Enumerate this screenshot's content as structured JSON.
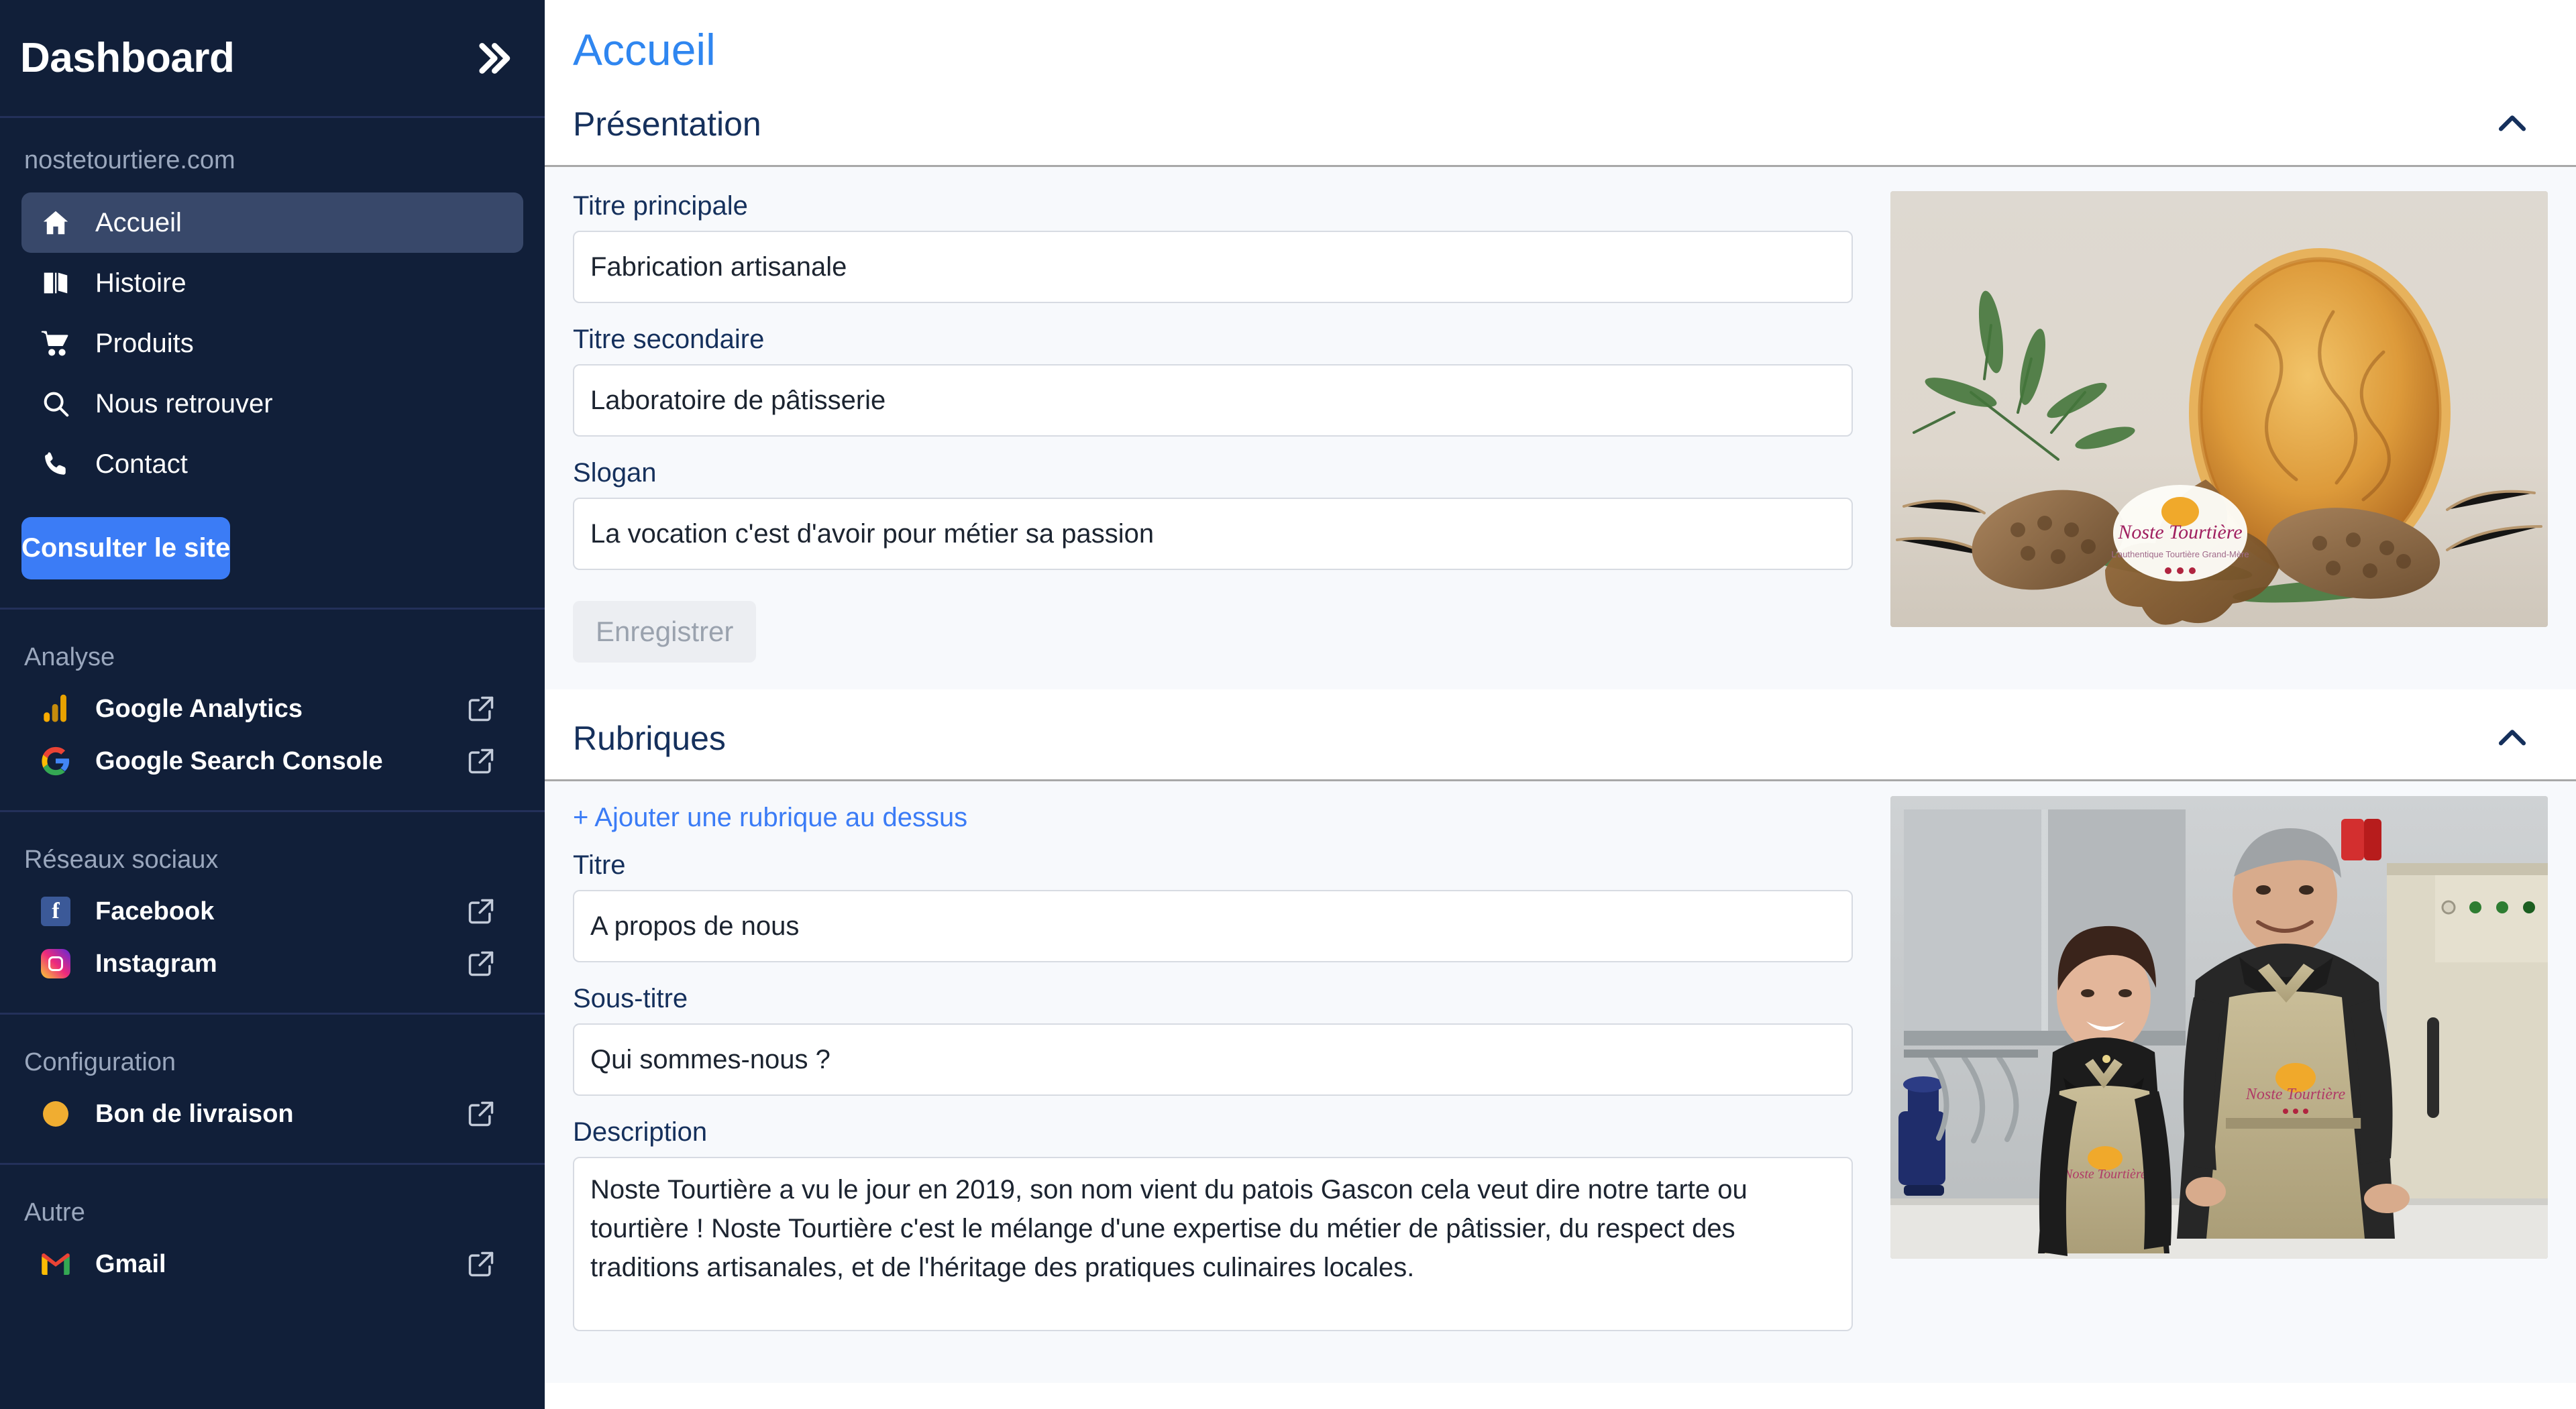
{
  "sidebar": {
    "title": "Dashboard",
    "collapse_icon": "chevron-double-right-icon",
    "domain": "nostetourtiere.com",
    "nav": [
      {
        "label": "Accueil",
        "icon": "home-icon",
        "active": true
      },
      {
        "label": "Histoire",
        "icon": "book-icon",
        "active": false
      },
      {
        "label": "Produits",
        "icon": "cart-icon",
        "active": false
      },
      {
        "label": "Nous retrouver",
        "icon": "search-icon",
        "active": false
      },
      {
        "label": "Contact",
        "icon": "phone-icon",
        "active": false
      }
    ],
    "cta_label": "Consulter le site",
    "groups": [
      {
        "label": "Analyse",
        "items": [
          {
            "label": "Google Analytics",
            "icon": "google-analytics-icon",
            "external": true
          },
          {
            "label": "Google Search Console",
            "icon": "google-search-console-icon",
            "external": true
          }
        ]
      },
      {
        "label": "Réseaux sociaux",
        "items": [
          {
            "label": "Facebook",
            "icon": "facebook-icon",
            "external": true
          },
          {
            "label": "Instagram",
            "icon": "instagram-icon",
            "external": true
          }
        ]
      },
      {
        "label": "Configuration",
        "items": [
          {
            "label": "Bon de livraison",
            "icon": "orange-dot-icon",
            "external": true
          }
        ]
      },
      {
        "label": "Autre",
        "items": [
          {
            "label": "Gmail",
            "icon": "gmail-icon",
            "external": true
          }
        ]
      }
    ]
  },
  "main": {
    "page_title": "Accueil",
    "presentation": {
      "heading": "Présentation",
      "collapse_icon": "chevron-up-icon",
      "fields": {
        "titre_principale_label": "Titre principale",
        "titre_principale_value": "Fabrication artisanale",
        "titre_secondaire_label": "Titre secondaire",
        "titre_secondaire_value": "Laboratoire de pâtisserie",
        "slogan_label": "Slogan",
        "slogan_value": "La vocation c'est d'avoir pour métier sa passion"
      },
      "save_label": "Enregistrer",
      "image_alt": "Tourtière dorée posée sur un décor de pommes de pin et de branches de sapin"
    },
    "rubriques": {
      "heading": "Rubriques",
      "collapse_icon": "chevron-up-icon",
      "add_link": "+ Ajouter une rubrique au dessus",
      "fields": {
        "titre_label": "Titre",
        "titre_value": "A propos de nous",
        "sous_titre_label": "Sous-titre",
        "sous_titre_value": "Qui sommes-nous ?",
        "description_label": "Description",
        "description_value": "Noste Tourtière a vu le jour en 2019, son nom vient du patois Gascon cela veut dire notre tarte ou tourtière ! Noste Tourtière c'est le mélange d'une expertise du métier de pâtissier, du respect des traditions artisanales, et de l'héritage des pratiques culinaires locales."
      },
      "image_alt": "Deux pâtissiers souriants en tablier dans leur laboratoire"
    }
  },
  "colors": {
    "sidebar_bg": "#111f39",
    "sidebar_divider": "#23305a",
    "accent_blue": "#3b7cf6",
    "title_blue": "#2f86f0",
    "heading_navy": "#15305c",
    "panel_bg": "#f7f9fc",
    "muted": "#9aa7bd"
  }
}
